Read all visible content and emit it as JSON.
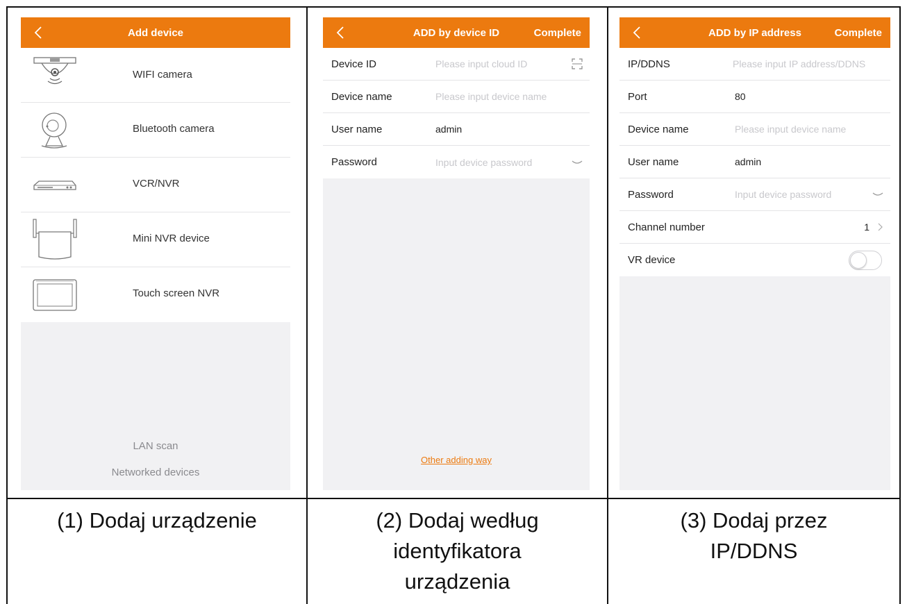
{
  "panel1": {
    "title": "Add device",
    "devices": [
      {
        "label": "WIFI camera",
        "icon": "wifi-camera-icon"
      },
      {
        "label": "Bluetooth camera",
        "icon": "bluetooth-camera-icon"
      },
      {
        "label": "VCR/NVR",
        "icon": "vcr-nvr-icon"
      },
      {
        "label": "Mini NVR device",
        "icon": "mini-nvr-icon"
      },
      {
        "label": "Touch screen NVR",
        "icon": "touch-screen-nvr-icon"
      }
    ],
    "lan_scan": "LAN scan",
    "networked_devices": "Networked devices",
    "caption": "(1) Dodaj urządzenie"
  },
  "panel2": {
    "title": "ADD by device ID",
    "complete": "Complete",
    "fields": [
      {
        "label": "Device ID",
        "value": "",
        "placeholder": "Please input cloud ID"
      },
      {
        "label": "Device name",
        "value": "",
        "placeholder": "Please input device name"
      },
      {
        "label": "User name",
        "value": "admin",
        "placeholder": ""
      },
      {
        "label": "Password",
        "value": "",
        "placeholder": "Input device password"
      }
    ],
    "other_way": "Other adding way",
    "caption_lines": [
      "(2) Dodaj według",
      "identyfikatora",
      "urządzenia"
    ]
  },
  "panel3": {
    "title": "ADD by IP address",
    "complete": "Complete",
    "fields": [
      {
        "label": "IP/DDNS",
        "value": "",
        "placeholder": "Please input IP address/DDNS"
      },
      {
        "label": "Port",
        "value": "80",
        "placeholder": ""
      },
      {
        "label": "Device name",
        "value": "",
        "placeholder": "Please input device name"
      },
      {
        "label": "User name",
        "value": "admin",
        "placeholder": ""
      },
      {
        "label": "Password",
        "value": "",
        "placeholder": "Input device password"
      },
      {
        "label": "Channel number",
        "value": "1",
        "placeholder": ""
      },
      {
        "label": "VR device",
        "value": "",
        "placeholder": ""
      }
    ],
    "caption_lines": [
      "(3) Dodaj przez",
      "IP/DDNS"
    ]
  },
  "colors": {
    "accent": "#ec7a0f",
    "background": "#f1f1f3",
    "placeholder": "#c8c8cc"
  }
}
